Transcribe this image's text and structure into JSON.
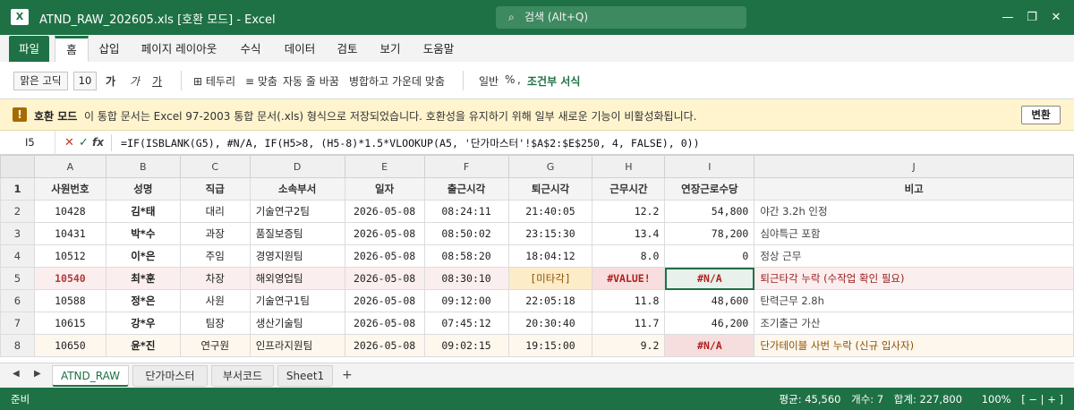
{
  "titlebar": {
    "app_letter": "X",
    "title": "ATND_RAW_202605.xls [호환 모드] - Excel",
    "search_placeholder": "검색 (Alt+Q)",
    "min": "—",
    "restore": "❐",
    "close": "✕"
  },
  "ribbon_tabs": [
    "파일",
    "홈",
    "삽입",
    "페이지 레이아웃",
    "수식",
    "데이터",
    "검토",
    "보기",
    "도움말"
  ],
  "toolbar": {
    "font_name": "맑은 고딕",
    "font_size": "10",
    "bold": "가",
    "italic": "가",
    "underline": "가",
    "border": "⊞ 테두리",
    "align": "≡ 맞춤",
    "wrap": "자동 줄 바꿈",
    "merge": "병합하고 가운데 맞춤",
    "number_format": "일반",
    "percent": "%",
    "comma": ",",
    "conditional": "조건부 서식"
  },
  "banner": {
    "icon": "!",
    "title": "호환 모드",
    "message": "이 통합 문서는 Excel 97-2003 통합 문서(.xls) 형식으로 저장되었습니다. 호환성을 유지하기 위해 일부 새로운 기능이 비활성화됩니다.",
    "button": "변환"
  },
  "formula_bar": {
    "cell_ref": "I5",
    "cancel": "✕",
    "enter": "✓",
    "fx": "fx",
    "formula": "=IF(ISBLANK(G5), #N/A, IF(H5>8, (H5-8)*1.5*VLOOKUP(A5, '단가마스터'!$A$2:$E$250, 4, FALSE), 0))"
  },
  "columns": [
    "A",
    "B",
    "C",
    "D",
    "E",
    "F",
    "G",
    "H",
    "I",
    "J"
  ],
  "header_row": {
    "num": "1",
    "cells": [
      "사원번호",
      "성명",
      "직급",
      "소속부서",
      "일자",
      "출근시각",
      "퇴근시각",
      "근무시간",
      "연장근로수당",
      "비고"
    ]
  },
  "rows": [
    {
      "num": "2",
      "id": "10428",
      "name": "김*태",
      "rank": "대리",
      "dept": "기술연구2팀",
      "date": "2026-05-08",
      "in": "08:24:11",
      "out": "21:40:05",
      "hours": "12.2",
      "pay": "54,800",
      "note": "야간 3.2h 인정"
    },
    {
      "num": "3",
      "id": "10431",
      "name": "박*수",
      "rank": "과장",
      "dept": "품질보증팀",
      "date": "2026-05-08",
      "in": "08:50:02",
      "out": "23:15:30",
      "hours": "13.4",
      "pay": "78,200",
      "note": "심야특근 포함"
    },
    {
      "num": "4",
      "id": "10512",
      "name": "이*은",
      "rank": "주임",
      "dept": "경영지원팀",
      "date": "2026-05-08",
      "in": "08:58:20",
      "out": "18:04:12",
      "hours": "8.0",
      "pay": "0",
      "note": "정상 근무"
    },
    {
      "num": "5",
      "id": "10540",
      "name": "최*훈",
      "rank": "차장",
      "dept": "해외영업팀",
      "date": "2026-05-08",
      "in": "08:30:10",
      "out": "[미타각]",
      "hours": "#VALUE!",
      "pay": "#N/A",
      "note": "퇴근타각 누락 (수작업 확인 필요)"
    },
    {
      "num": "6",
      "id": "10588",
      "name": "정*은",
      "rank": "사원",
      "dept": "기술연구1팀",
      "date": "2026-05-08",
      "in": "09:12:00",
      "out": "22:05:18",
      "hours": "11.8",
      "pay": "48,600",
      "note": "탄력근무 2.8h"
    },
    {
      "num": "7",
      "id": "10615",
      "name": "강*우",
      "rank": "팀장",
      "dept": "생산기술팀",
      "date": "2026-05-08",
      "in": "07:45:12",
      "out": "20:30:40",
      "hours": "11.7",
      "pay": "46,200",
      "note": "조기출근 가산"
    },
    {
      "num": "8",
      "id": "10650",
      "name": "윤*진",
      "rank": "연구원",
      "dept": "인프라지원팀",
      "date": "2026-05-08",
      "in": "09:02:15",
      "out": "19:15:00",
      "hours": "9.2",
      "pay": "#N/A",
      "note": "단가테이블 사번 누락 (신규 입사자)"
    }
  ],
  "sheet_tabs": [
    "ATND_RAW",
    "단가마스터",
    "부서코드",
    "Sheet1"
  ],
  "sheet_nav": {
    "prev": "◀",
    "next": "▶",
    "add": "+"
  },
  "status": {
    "ready": "준비",
    "average": "평균: 45,560",
    "count": "개수: 7",
    "sum": "합계: 227,800",
    "zoom": "100%",
    "zoom_controls": "[ − | + ]"
  },
  "colors": {
    "brand": "#1e7145",
    "banner_bg": "#fff4ce",
    "error_text": "#b02020"
  }
}
